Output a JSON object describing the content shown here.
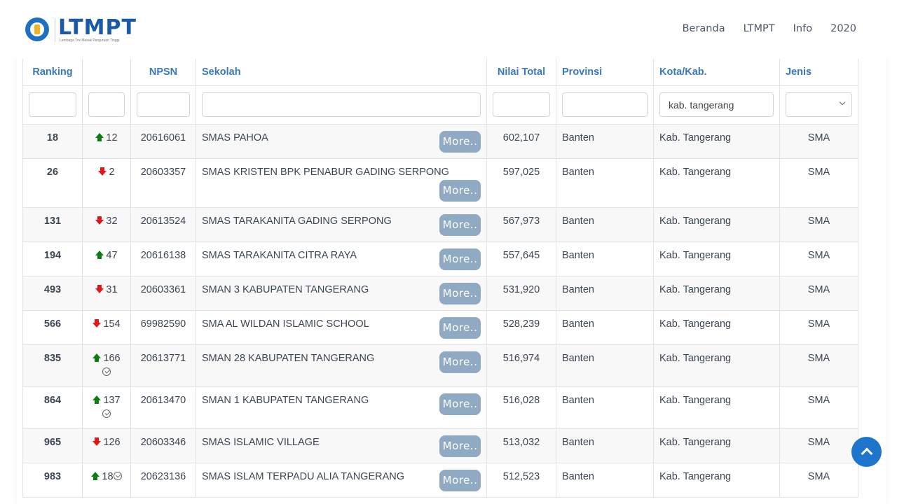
{
  "navbar": {
    "logo": {
      "title": "LTMPT",
      "subtitle": "Lembaga Tes Masuk Perguruan Tinggi"
    },
    "links": [
      "Beranda",
      "LTMPT",
      "Info",
      "2020"
    ]
  },
  "table": {
    "columns": [
      "Ranking",
      "",
      "NPSN",
      "Sekolah",
      "Nilai Total",
      "Provinsi",
      "Kota/Kab.",
      "Jenis"
    ],
    "filters": {
      "ranking": "",
      "change": "",
      "npsn": "",
      "sekolah": "",
      "nilai": "",
      "provinsi": "",
      "kota": "kab. tangerang",
      "jenis": ""
    },
    "more_label": "More..",
    "rows": [
      {
        "rank": "18",
        "direction": "up",
        "change": "12",
        "verified": false,
        "npsn": "20616061",
        "sekolah": "SMAS PAHOA",
        "nilai": "602,107",
        "provinsi": "Banten",
        "kota": "Kab. Tangerang",
        "jenis": "SMA"
      },
      {
        "rank": "26",
        "direction": "down",
        "change": "2",
        "verified": false,
        "npsn": "20603357",
        "sekolah": "SMAS KRISTEN BPK PENABUR GADING SERPONG",
        "nilai": "597,025",
        "provinsi": "Banten",
        "kota": "Kab. Tangerang",
        "jenis": "SMA"
      },
      {
        "rank": "131",
        "direction": "down",
        "change": "32",
        "verified": false,
        "npsn": "20613524",
        "sekolah": "SMAS TARAKANITA GADING SERPONG",
        "nilai": "567,973",
        "provinsi": "Banten",
        "kota": "Kab. Tangerang",
        "jenis": "SMA"
      },
      {
        "rank": "194",
        "direction": "up",
        "change": "47",
        "verified": false,
        "npsn": "20616138",
        "sekolah": "SMAS TARAKANITA CITRA RAYA",
        "nilai": "557,645",
        "provinsi": "Banten",
        "kota": "Kab. Tangerang",
        "jenis": "SMA"
      },
      {
        "rank": "493",
        "direction": "down",
        "change": "31",
        "verified": false,
        "npsn": "20603361",
        "sekolah": "SMAN 3 KABUPATEN TANGERANG",
        "nilai": "531,920",
        "provinsi": "Banten",
        "kota": "Kab. Tangerang",
        "jenis": "SMA"
      },
      {
        "rank": "566",
        "direction": "down",
        "change": "154",
        "verified": false,
        "npsn": "69982590",
        "sekolah": "SMA AL WILDAN ISLAMIC SCHOOL",
        "nilai": "528,239",
        "provinsi": "Banten",
        "kota": "Kab. Tangerang",
        "jenis": "SMA"
      },
      {
        "rank": "835",
        "direction": "up",
        "change": "166",
        "verified": true,
        "npsn": "20613771",
        "sekolah": "SMAN 28 KABUPATEN TANGERANG",
        "nilai": "516,974",
        "provinsi": "Banten",
        "kota": "Kab. Tangerang",
        "jenis": "SMA"
      },
      {
        "rank": "864",
        "direction": "up",
        "change": "137",
        "verified": true,
        "npsn": "20613470",
        "sekolah": "SMAN 1 KABUPATEN TANGERANG",
        "nilai": "516,028",
        "provinsi": "Banten",
        "kota": "Kab. Tangerang",
        "jenis": "SMA"
      },
      {
        "rank": "965",
        "direction": "down",
        "change": "126",
        "verified": false,
        "npsn": "20603346",
        "sekolah": "SMAS ISLAMIC VILLAGE",
        "nilai": "513,032",
        "provinsi": "Banten",
        "kota": "Kab. Tangerang",
        "jenis": "SMA"
      },
      {
        "rank": "983",
        "direction": "up",
        "change": "18",
        "verified": true,
        "npsn": "20623136",
        "sekolah": "SMAS ISLAM TERPADU ALIA TANGERANG",
        "nilai": "512,523",
        "provinsi": "Banten",
        "kota": "Kab. Tangerang",
        "jenis": "SMA"
      }
    ]
  },
  "colors": {
    "header_text": "#3a78b7",
    "up_arrow": "#0d7a12",
    "down_arrow": "#e01818",
    "more_button": "#8faac2",
    "scroll_top_button": "#1f75cb"
  }
}
